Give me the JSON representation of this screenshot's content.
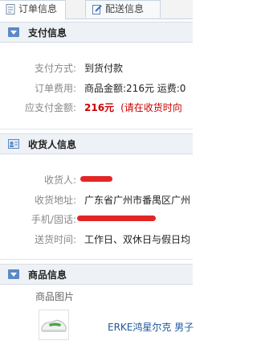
{
  "tabs": [
    {
      "label": "订单信息",
      "icon": "document-icon"
    },
    {
      "label": "配送信息",
      "icon": "edit-icon"
    }
  ],
  "payment": {
    "title": "支付信息",
    "method_label": "支付方式:",
    "method_value": "到货付款",
    "fee_label": "订单费用:",
    "fee_value": "商品金额:216元   运费:0",
    "due_label": "应支付金额:",
    "due_value": "216元",
    "due_note": "(请在收货时向"
  },
  "consignee": {
    "title": "收货人信息",
    "name_label": "收货人:",
    "address_label": "收货地址:",
    "address_value": "广东省广州市番禺区广州",
    "phone_label": "手机/固话:",
    "delivery_time_label": "送货时间:",
    "delivery_time_value": "工作日、双休日与假日均"
  },
  "products": {
    "title": "商品信息",
    "image_column": "商品图片",
    "item_name": "ERKE鸿星尔克 男子"
  }
}
